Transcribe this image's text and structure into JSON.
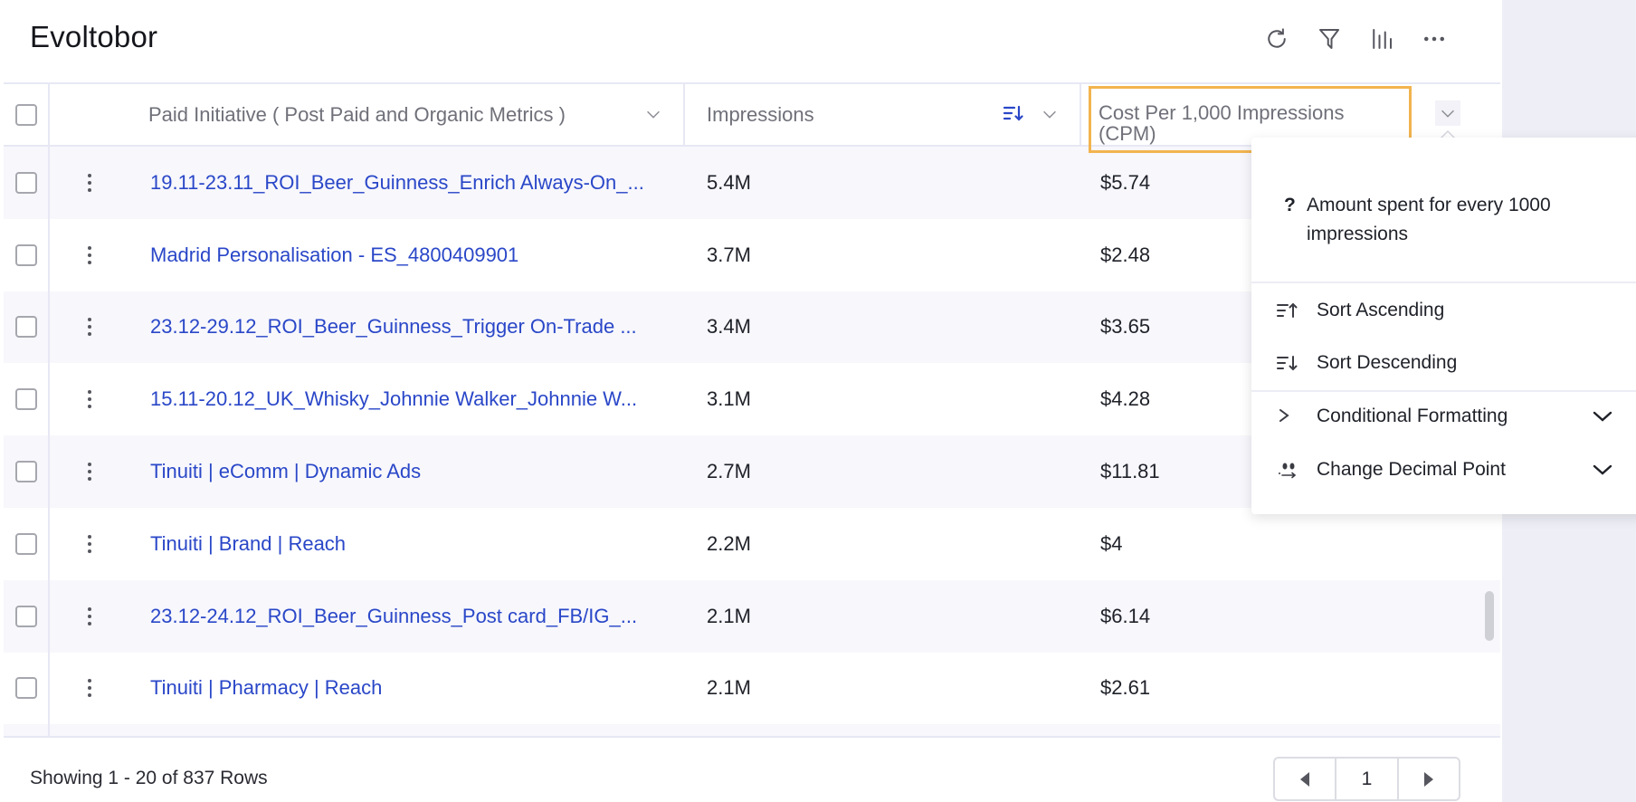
{
  "header": {
    "title": "Evoltobor",
    "toolbar": [
      {
        "name": "refresh-icon",
        "label": "Refresh"
      },
      {
        "name": "filter-icon",
        "label": "Filter"
      },
      {
        "name": "columns-icon",
        "label": "Columns"
      },
      {
        "name": "more-icon",
        "label": "More"
      }
    ]
  },
  "table": {
    "columns": {
      "name": "Paid Initiative ( Post Paid and Organic Metrics )",
      "impressions": "Impressions",
      "cpm": "Cost Per 1,000 Impressions (CPM)"
    },
    "impressions_sorted": "descending",
    "rows": [
      {
        "name": "19.11-23.11_ROI_Beer_Guinness_Enrich Always-On_...",
        "impressions": "5.4M",
        "cpm": "$5.74"
      },
      {
        "name": "Madrid Personalisation - ES_4800409901",
        "impressions": "3.7M",
        "cpm": "$2.48"
      },
      {
        "name": "23.12-29.12_ROI_Beer_Guinness_Trigger On-Trade ...",
        "impressions": "3.4M",
        "cpm": "$3.65"
      },
      {
        "name": "15.11-20.12_UK_Whisky_Johnnie Walker_Johnnie W...",
        "impressions": "3.1M",
        "cpm": "$4.28"
      },
      {
        "name": "Tinuiti | eComm | Dynamic Ads",
        "impressions": "2.7M",
        "cpm": "$11.81"
      },
      {
        "name": "Tinuiti | Brand | Reach",
        "impressions": "2.2M",
        "cpm": "$4"
      },
      {
        "name": "23.12-24.12_ROI_Beer_Guinness_Post card_FB/IG_...",
        "impressions": "2.1M",
        "cpm": "$6.14"
      },
      {
        "name": "Tinuiti | Pharmacy | Reach",
        "impressions": "2.1M",
        "cpm": "$2.61"
      }
    ]
  },
  "column_menu": {
    "description_icon": "?",
    "description": "Amount spent for every 1000 impressions",
    "items": [
      {
        "label": "Sort Ascending",
        "icon": "sort-ascending-icon"
      },
      {
        "label": "Sort Descending",
        "icon": "sort-descending-icon"
      },
      {
        "label": "Conditional Formatting",
        "icon": "chevron-right-icon",
        "expandable": true
      },
      {
        "label": "Change Decimal Point",
        "icon": "decimal-point-icon",
        "expandable": true
      }
    ]
  },
  "footer": {
    "showing": "Showing 1 - 20 of 837 Rows",
    "current_page": "1"
  },
  "colors": {
    "link": "#2a47c8",
    "highlight": "#f2b44f",
    "sort_indicator": "#2a47c8",
    "side_panel": "#eeeef6"
  }
}
